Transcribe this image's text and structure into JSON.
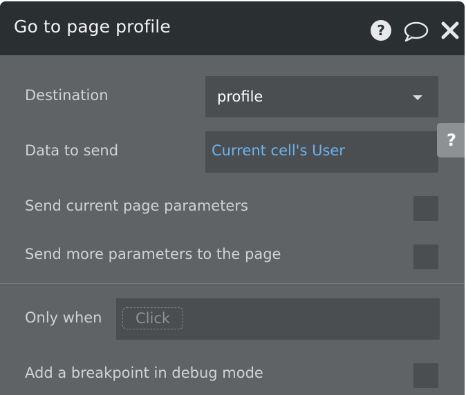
{
  "header": {
    "title": "Go to page profile",
    "help_icon": "help-circle-icon",
    "comment_icon": "comment-bubble-icon",
    "close_icon": "close-icon"
  },
  "form": {
    "destination": {
      "label": "Destination",
      "value": "profile"
    },
    "data_to_send": {
      "label": "Data to send",
      "value": "Current cell's User"
    },
    "send_current_params": {
      "label": "Send current page parameters",
      "checked": false
    },
    "send_more_params": {
      "label": "Send more parameters to the page",
      "checked": false
    },
    "only_when": {
      "label": "Only when",
      "placeholder": "Click"
    },
    "breakpoint": {
      "label": "Add a breakpoint in debug mode",
      "checked": false
    }
  },
  "side_tab": {
    "label": "?"
  },
  "colors": {
    "header_bg": "#2a2f32",
    "panel_bg": "#5f6366",
    "field_bg": "#4a4e51",
    "link_blue": "#6bb4f0"
  }
}
